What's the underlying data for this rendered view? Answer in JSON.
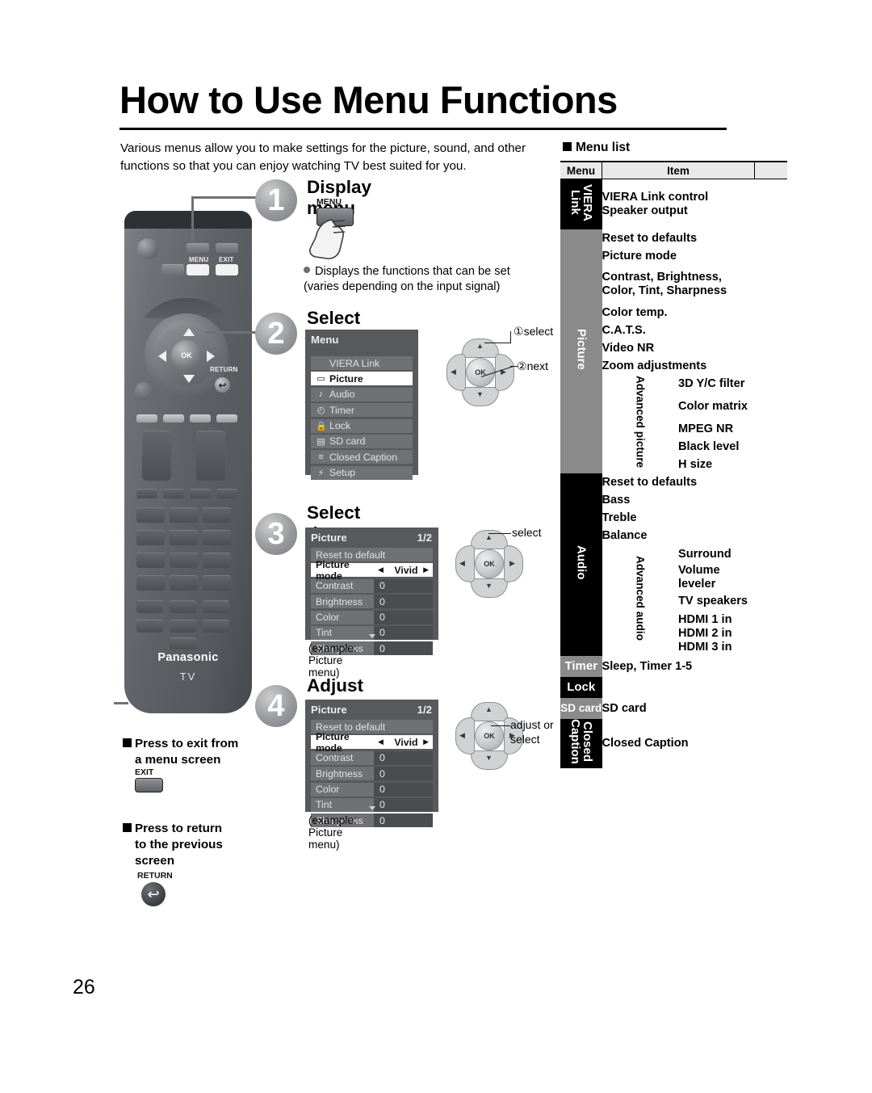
{
  "page": {
    "title": "How to Use Menu Functions",
    "intro": "Various menus allow you to make settings for the picture, sound, and other functions so that you can enjoy watching TV best suited for you.",
    "page_number": "26"
  },
  "remote": {
    "menu_label": "MENU",
    "exit_label": "EXIT",
    "ok_label": "OK",
    "return_label": "RETURN",
    "return_glyph": "↩",
    "brand": "Panasonic",
    "device": "TV"
  },
  "steps": [
    {
      "number": "1",
      "title": "Display menu",
      "key_label": "MENU",
      "bullet": "Displays the functions that can be set (varies depending on the input signal)"
    },
    {
      "number": "2",
      "title": "Select the menu",
      "osd": {
        "header": "Menu",
        "rows": [
          {
            "icon": "",
            "label": "VIERA Link",
            "selected": false
          },
          {
            "icon": "▭",
            "label": "Picture",
            "selected": true
          },
          {
            "icon": "♪",
            "label": "Audio",
            "selected": false
          },
          {
            "icon": "◴",
            "label": "Timer",
            "selected": false
          },
          {
            "icon": "ὑ2",
            "label": "Lock",
            "selected": false
          },
          {
            "icon": "▤",
            "label": "SD card",
            "selected": false
          },
          {
            "icon": "≡",
            "label": "Closed Caption",
            "selected": false
          },
          {
            "icon": "⚡",
            "label": "Setup",
            "selected": false
          }
        ]
      },
      "callouts": [
        {
          "marker": "①",
          "text": "select"
        },
        {
          "marker": "②",
          "text": "next"
        }
      ]
    },
    {
      "number": "3",
      "title": "Select the item",
      "osd": {
        "header": "Picture",
        "page_indicator": "1/2",
        "reset_row": "Reset to default",
        "mode_row": {
          "key": "Picture mode",
          "value": "Vivid",
          "left_arrow": "◀",
          "right_arrow": "▶"
        },
        "values": [
          {
            "key": "Contrast",
            "value": "0"
          },
          {
            "key": "Brightness",
            "value": "0"
          },
          {
            "key": "Color",
            "value": "0"
          },
          {
            "key": "Tint",
            "value": "0"
          },
          {
            "key": "Sharpness",
            "value": "0"
          }
        ]
      },
      "example_caption": "(example:  Picture menu)",
      "callouts": [
        {
          "marker": "",
          "text": "select"
        }
      ]
    },
    {
      "number": "4",
      "title": "Adjust or select",
      "osd": {
        "header": "Picture",
        "page_indicator": "1/2",
        "reset_row": "Reset to default",
        "mode_row": {
          "key": "Picture mode",
          "value": "Vivid",
          "left_arrow": "◀",
          "right_arrow": "▶"
        },
        "values": [
          {
            "key": "Contrast",
            "value": "0"
          },
          {
            "key": "Brightness",
            "value": "0"
          },
          {
            "key": "Color",
            "value": "0"
          },
          {
            "key": "Tint",
            "value": "0"
          },
          {
            "key": "Sharpness",
            "value": "0"
          }
        ]
      },
      "example_caption": "(example:  Picture menu)",
      "callouts": [
        {
          "marker": "",
          "text": "adjust or select"
        }
      ]
    }
  ],
  "notes": [
    {
      "text_line1": "Press to exit from",
      "text_line2": "a menu screen",
      "key_label": "EXIT",
      "key_type": "button"
    },
    {
      "text_line1": "Press to return",
      "text_line2": "to the previous",
      "text_line3": "screen",
      "key_label": "RETURN",
      "key_type": "round",
      "glyph": "↩"
    }
  ],
  "menu_list": {
    "heading": "Menu list",
    "columns": [
      "Menu",
      "Item",
      ""
    ],
    "groups": [
      {
        "category": "VIERA Link",
        "category_lines": [
          "VIERA",
          "Link"
        ],
        "category_style": "black",
        "orientation": "vertical",
        "items": [
          {
            "label": "VIERA Link control\nSpeaker output",
            "lines": [
              "VIERA Link control",
              "Speaker output"
            ]
          }
        ]
      },
      {
        "category": "Picture",
        "category_lines": [
          "Picture"
        ],
        "category_style": "gray",
        "orientation": "vertical",
        "items": [
          {
            "lines": [
              "Reset to defaults"
            ]
          },
          {
            "lines": [
              "Picture mode"
            ]
          },
          {
            "lines": [
              "Contrast, Brightness,",
              "Color, Tint, Sharpness"
            ]
          },
          {
            "lines": [
              "Color temp."
            ]
          },
          {
            "lines": [
              "C.A.T.S."
            ]
          },
          {
            "lines": [
              "Video NR"
            ]
          },
          {
            "lines": [
              "Zoom adjustments"
            ]
          }
        ],
        "subgroup": {
          "label": "Advanced picture",
          "items": [
            {
              "lines": [
                "3D Y/C filter"
              ]
            },
            {
              "lines": [
                "Color matrix"
              ]
            },
            {
              "lines": [
                "MPEG NR"
              ]
            },
            {
              "lines": [
                "Black level"
              ]
            },
            {
              "lines": [
                "H size"
              ]
            }
          ]
        }
      },
      {
        "category": "Audio",
        "category_lines": [
          "Audio"
        ],
        "category_style": "black",
        "orientation": "vertical",
        "items": [
          {
            "lines": [
              "Reset to defaults"
            ]
          },
          {
            "lines": [
              "Bass"
            ]
          },
          {
            "lines": [
              "Treble"
            ]
          },
          {
            "lines": [
              "Balance"
            ]
          }
        ],
        "subgroup": {
          "label": "Advanced audio",
          "items": [
            {
              "lines": [
                "Surround"
              ]
            },
            {
              "lines": [
                "Volume leveler"
              ]
            },
            {
              "lines": [
                "TV speakers"
              ]
            },
            {
              "lines": [
                "HDMI 1 in",
                "HDMI 2 in",
                "HDMI 3 in"
              ]
            }
          ]
        }
      },
      {
        "category": "Timer",
        "category_lines": [
          "Timer"
        ],
        "category_style": "gray",
        "orientation": "horizontal",
        "items": [
          {
            "lines": [
              "Sleep, Timer 1-5"
            ]
          }
        ]
      },
      {
        "category": "Lock",
        "category_lines": [
          "Lock"
        ],
        "category_style": "black",
        "orientation": "horizontal",
        "items": [
          {
            "lines": [
              ""
            ]
          }
        ]
      },
      {
        "category": "SD card",
        "category_lines": [
          "SD card"
        ],
        "category_style": "gray",
        "orientation": "horizontal",
        "items": [
          {
            "lines": [
              "SD card"
            ]
          }
        ]
      },
      {
        "category": "Closed Caption",
        "category_lines": [
          "Closed",
          "Caption"
        ],
        "category_style": "black",
        "orientation": "vertical",
        "items": [
          {
            "lines": [
              "Closed Caption"
            ]
          }
        ]
      }
    ]
  }
}
